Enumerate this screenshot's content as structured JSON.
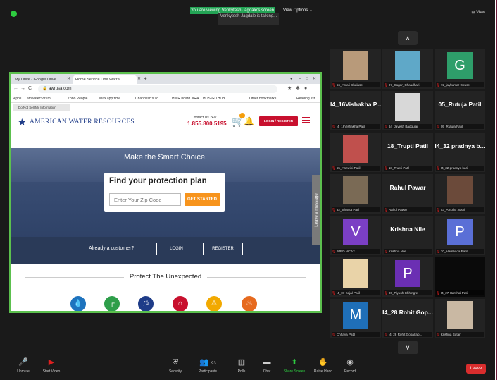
{
  "banner": {
    "viewing": "You are viewing Venkytesh Jagdale's screen",
    "talking": "Venkytesh Jagdale is talking...",
    "view_options": "View Options ⌄",
    "view": "⊞ View"
  },
  "browser": {
    "tabs": [
      "My Drive - Google Drive",
      "Home Service Line Warra..."
    ],
    "url": "awrusa.com",
    "bookmarks": [
      "Apps",
      "amwaterScrum",
      "Zoho People",
      "Max.app.time...",
      "Chandesh's zo...",
      "HWR board JIRA",
      "HOS-GITHUB",
      "Other bookmarks",
      "Reading list"
    ],
    "do_not_sell": "Do Not Sell My Information"
  },
  "site": {
    "logo": "AMERICAN WATER RESOURCES",
    "contact_label": "Contact Us 24/7",
    "phone": "1.855.800.5195",
    "login_register": "LOGIN / REGISTER",
    "hero_title": "Make the Smart Choice.",
    "find_title": "Find your protection plan",
    "zip_placeholder": "Enter Your Zip Code",
    "get_started": "GET STARTED",
    "leave_message": "Leave a message",
    "already": "Already a customer?",
    "login": "LOGIN",
    "register": "REGISTER",
    "protect": "Protect The Unexpected",
    "protect_icons": [
      "water-drop-icon",
      "pipe-icon",
      "sewer-icon",
      "home-icon",
      "warning-icon",
      "fire-icon"
    ]
  },
  "participants": [
    {
      "label": "56_Anjali Chalase",
      "kind": "photo",
      "color": "#b89a7a"
    },
    {
      "label": "97_Sagar_Chaudhari",
      "kind": "photo",
      "color": "#5fa8c8"
    },
    {
      "label": "72_jaykumar Girase",
      "kind": "avatar",
      "initial": "G",
      "color": "#2e9e6a"
    },
    {
      "label": "I4_16Vishakha Patil",
      "kind": "name",
      "big": "I4_16Vishakha P..."
    },
    {
      "label": "64_Jayesh Badgujar",
      "kind": "photo",
      "color": "#d8d8d8"
    },
    {
      "label": "05_Rutuja Patil",
      "kind": "name",
      "big": "05_Rutuja Patil"
    },
    {
      "label": "55_Ashwini Patil",
      "kind": "photo",
      "color": "#c0504d"
    },
    {
      "label": "18_Trupti Patil",
      "kind": "name",
      "big": "18_Trupti Patil"
    },
    {
      "label": "I4_32 pradnya bari",
      "kind": "name",
      "big": "I4_32 pradnya b..."
    },
    {
      "label": "32_Shanta Patil",
      "kind": "photo",
      "color": "#7a6a55"
    },
    {
      "label": "Rahul Pawar",
      "kind": "name",
      "big": "Rahul Pawar"
    },
    {
      "label": "53_Amol B Joshi",
      "kind": "photo",
      "color": "#6b4a3a"
    },
    {
      "label": "IMRD MCA2",
      "kind": "avatar",
      "initial": "V",
      "color": "#7b3fc4"
    },
    {
      "label": "Krishna Nile",
      "kind": "name",
      "big": "Krishna Nile"
    },
    {
      "label": "20_Harshada Patil",
      "kind": "avatar",
      "initial": "P",
      "color": "#5a6fd6"
    },
    {
      "label": "I4_07 Kajal Patil",
      "kind": "photo",
      "color": "#e9d3a8"
    },
    {
      "label": "90_Piyush Chhingre",
      "kind": "avatar",
      "initial": "P",
      "color": "#6b2fb3"
    },
    {
      "label": "I4_27 Harshal Patil",
      "kind": "blank",
      "color": "#0a0a0a"
    },
    {
      "label": "Chhaya Patil",
      "kind": "avatar",
      "initial": "M",
      "color": "#1f6fb8"
    },
    {
      "label": "I4_28 Rohit Gopalrao...",
      "kind": "name",
      "big": "I4_28 Rohit Gop..."
    },
    {
      "label": "Krishna Sutar",
      "kind": "photo",
      "color": "#c9b8a3"
    }
  ],
  "toolbar": {
    "unmute": "Unmute",
    "start_video": "Start Video",
    "security": "Security",
    "participants": "Participants",
    "participants_count": "93",
    "polls": "Polls",
    "chat": "Chat",
    "share_screen": "Share Screen",
    "raise_hand": "Raise Hand",
    "record": "Record",
    "leave": "Leave"
  }
}
